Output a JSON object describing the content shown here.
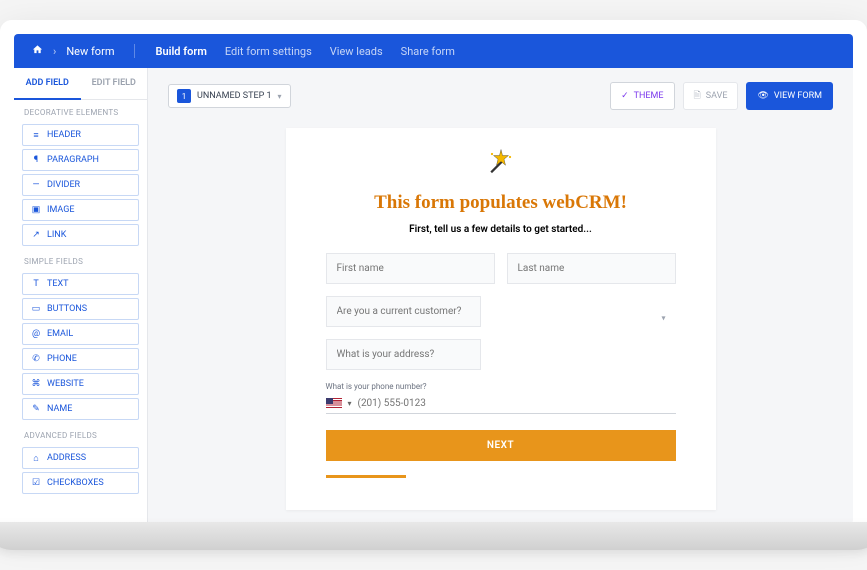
{
  "breadcrumb": {
    "current": "New form"
  },
  "topnav": {
    "items": [
      {
        "label": "Build form",
        "active": true
      },
      {
        "label": "Edit form settings"
      },
      {
        "label": "View leads"
      },
      {
        "label": "Share form"
      }
    ]
  },
  "sidebar": {
    "tabs": {
      "add": "ADD FIELD",
      "edit": "EDIT FIELD"
    },
    "sections": {
      "decorative": "DECORATIVE ELEMENTS",
      "simple": "SIMPLE FIELDS",
      "advanced": "ADVANCED FIELDS"
    },
    "decorative_items": [
      {
        "label": "HEADER"
      },
      {
        "label": "PARAGRAPH"
      },
      {
        "label": "DIVIDER"
      },
      {
        "label": "IMAGE"
      },
      {
        "label": "LINK"
      }
    ],
    "simple_items": [
      {
        "label": "TEXT"
      },
      {
        "label": "BUTTONS"
      },
      {
        "label": "EMAIL"
      },
      {
        "label": "PHONE"
      },
      {
        "label": "WEBSITE"
      },
      {
        "label": "NAME"
      }
    ],
    "advanced_items": [
      {
        "label": "ADDRESS"
      },
      {
        "label": "CHECKBOXES"
      }
    ]
  },
  "canvas": {
    "step": {
      "num": "1",
      "label": "UNNAMED STEP 1"
    },
    "actions": {
      "theme": "THEME",
      "save": "SAVE",
      "view": "VIEW FORM"
    }
  },
  "form": {
    "title": "This form populates webCRM!",
    "subtitle": "First, tell us a few details to get started...",
    "first_name_ph": "First name",
    "last_name_ph": "Last name",
    "customer_ph": "Are you a current customer?",
    "address_ph": "What is your address?",
    "phone_label": "What is your phone number?",
    "phone_ph": "(201) 555-0123",
    "next_label": "NEXT"
  }
}
